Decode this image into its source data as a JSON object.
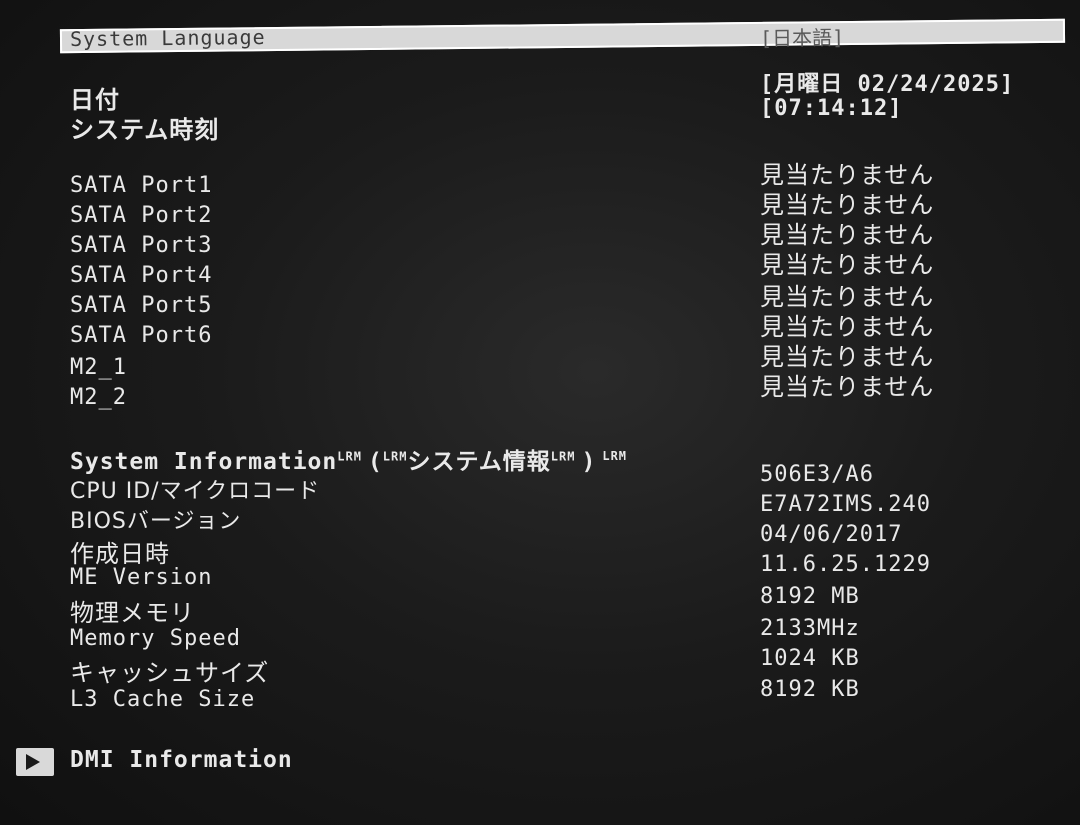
{
  "language": {
    "label": "System Language",
    "value": "[日本語]"
  },
  "datetime": {
    "date_label": "日付",
    "time_label": "システム時刻",
    "date_value": "[月曜日 02/24/2025]",
    "time_value": "[07:14:12]"
  },
  "storage": [
    {
      "label": "SATA Port1",
      "value": "見当たりません"
    },
    {
      "label": "SATA Port2",
      "value": "見当たりません"
    },
    {
      "label": "SATA Port3",
      "value": "見当たりません"
    },
    {
      "label": "SATA Port4",
      "value": "見当たりません"
    },
    {
      "label": "SATA Port5",
      "value": "見当たりません"
    },
    {
      "label": "SATA Port6",
      "value": "見当たりません"
    },
    {
      "label": "M2_1",
      "value": "見当たりません"
    },
    {
      "label": "M2_2",
      "value": "見当たりません"
    }
  ],
  "system_info": {
    "title_en": "System Information",
    "lrm1": "LRM",
    "open_paren": "(",
    "lrm2": "LRM",
    "title_jp": "システム情報",
    "lrm3": "LRM",
    "close_paren": ")",
    "lrm4": "LRM",
    "items": [
      {
        "label": "CPU ID/マイクロコード",
        "value": "506E3/A6"
      },
      {
        "label": "BIOSバージョン",
        "value": "E7A72IMS.240"
      },
      {
        "label": "作成日時",
        "value": "04/06/2017"
      },
      {
        "label": "ME Version",
        "value": "11.6.25.1229"
      },
      {
        "label": "物理メモリ",
        "value": "8192 MB"
      },
      {
        "label": "Memory Speed",
        "value": "2133MHz"
      },
      {
        "label": "キャッシュサイズ",
        "value": "1024 KB"
      },
      {
        "label": "L3 Cache Size",
        "value": "8192 KB"
      }
    ]
  },
  "dmi": {
    "label": "DMI Information",
    "icon": "submenu-arrow-icon"
  }
}
